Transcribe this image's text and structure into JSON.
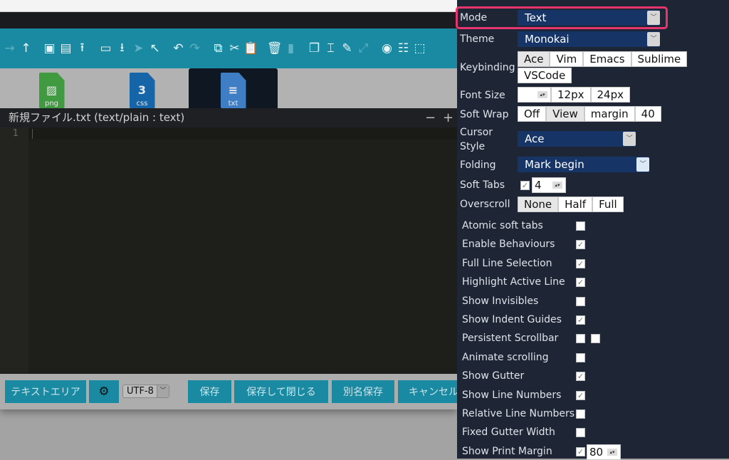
{
  "toolbar": {
    "icons": [
      "arrow-right-icon",
      "arrow-up-icon",
      "new-folder-icon",
      "new-file-icon",
      "upload-icon",
      "folder-icon",
      "download-icon",
      "pointer-icon",
      "cursor-icon",
      "undo-icon",
      "redo-icon",
      "copy-icon",
      "cut-icon",
      "paste-icon",
      "trash-icon",
      "shred-icon",
      "duplicate-icon",
      "rename-icon",
      "edit-icon",
      "resize-icon",
      "preview-icon",
      "select-all-icon",
      "select-icon"
    ]
  },
  "files": [
    {
      "label": "png",
      "color": "#3f9a40"
    },
    {
      "label": "css",
      "color": "#1565a8"
    },
    {
      "label": "txt",
      "color": "#3f7ec4",
      "active": true
    }
  ],
  "editor": {
    "title": "新規ファイル.txt (text/plain : text)",
    "minus": "−",
    "plus": "+",
    "line_numbers": [
      "1"
    ]
  },
  "bottom": {
    "textarea": "テキストエリア",
    "encoding": "UTF-8",
    "save": "保存",
    "save_close": "保存して閉じる",
    "save_as": "別名保存",
    "cancel": "キャンセル"
  },
  "settings": {
    "mode": {
      "label": "Mode",
      "value": "Text"
    },
    "theme": {
      "label": "Theme",
      "value": "Monokai"
    },
    "keybinding": {
      "label": "Keybinding",
      "options": [
        "Ace",
        "Vim",
        "Emacs",
        "Sublime",
        "VSCode"
      ],
      "selected": "Ace"
    },
    "font_size": {
      "label": "Font Size",
      "value": "",
      "options": [
        "12px",
        "24px"
      ]
    },
    "soft_wrap": {
      "label": "Soft Wrap",
      "options": [
        "Off",
        "View",
        "margin",
        "40"
      ],
      "selected": "View"
    },
    "cursor_style": {
      "label_1": "Cursor",
      "label_2": "Style",
      "value": "Ace"
    },
    "folding": {
      "label": "Folding",
      "value": "Mark begin"
    },
    "soft_tabs": {
      "label": "Soft Tabs",
      "checked": true,
      "value": "4"
    },
    "overscroll": {
      "label": "Overscroll",
      "options": [
        "None",
        "Half",
        "Full"
      ],
      "selected": "None"
    },
    "checkboxes": [
      {
        "label": "Atomic soft tabs",
        "checked": false
      },
      {
        "label": "Enable Behaviours",
        "checked": true
      },
      {
        "label": "Full Line Selection",
        "checked": true
      },
      {
        "label": "Highlight Active Line",
        "checked": true
      },
      {
        "label": "Show Invisibles",
        "checked": false
      },
      {
        "label": "Show Indent Guides",
        "checked": true
      },
      {
        "label": "Persistent Scrollbar",
        "checked": false,
        "checked2": false
      },
      {
        "label": "Animate scrolling",
        "checked": false
      },
      {
        "label": "Show Gutter",
        "checked": true
      },
      {
        "label": "Show Line Numbers",
        "checked": true
      },
      {
        "label": "Relative Line Numbers",
        "checked": false
      },
      {
        "label": "Fixed Gutter Width",
        "checked": false
      },
      {
        "label": "Show Print Margin",
        "checked": true,
        "value": "80"
      }
    ]
  },
  "colors": {
    "accent": "#1a8aa3",
    "panel": "#1e2635",
    "select": "#163466",
    "highlight": "#e8356d"
  }
}
